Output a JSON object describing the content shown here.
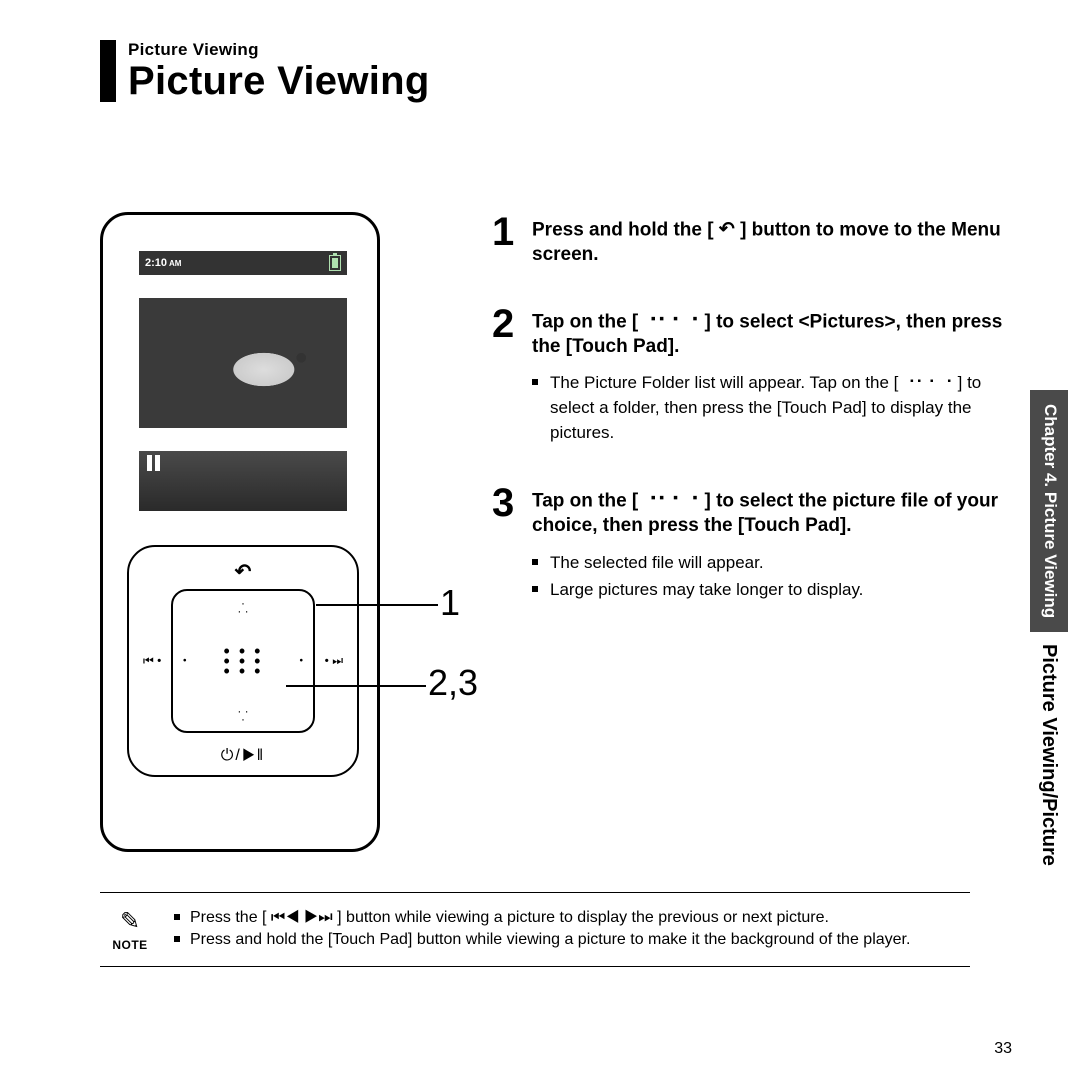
{
  "header": {
    "breadcrumb": "Picture Viewing",
    "title": "Picture Viewing"
  },
  "device": {
    "time": "2:10",
    "ampm": "AM",
    "callout_back": "1",
    "callout_pad": "2,3",
    "back_glyph": "↶",
    "power_glyph": "⏻/▶‖",
    "prev_glyph": "⏮ •",
    "next_glyph": "• ⏭"
  },
  "steps": [
    {
      "num": "1",
      "head_pre": "Press and hold the [ ",
      "head_glyph": "↶",
      "head_post": " ] button to move to the Menu screen.",
      "subs": []
    },
    {
      "num": "2",
      "head_pre": "Tap on the [ ",
      "head_glyph": "⠐⠂⠂⠐",
      "head_post": " ] to select <Pictures>, then press the [Touch Pad].",
      "subs": [
        "The Picture Folder list will appear. Tap on the [ ⠐⠂⠂⠐ ] to select a folder, then press the [Touch Pad] to display the pictures."
      ]
    },
    {
      "num": "3",
      "head_pre": "Tap on the [ ",
      "head_glyph": "⠐⠂⠂⠐",
      "head_post": " ] to select the picture file of your choice, then press the [Touch Pad].",
      "subs": [
        "The selected file will appear.",
        "Large pictures may take longer to display."
      ]
    }
  ],
  "note": {
    "icon": "✎",
    "label": "NOTE",
    "items": [
      "Press the [ ⏮◀ ▶⏭ ] button while viewing a picture to display the previous or next picture.",
      "Press and hold the [Touch Pad] button while viewing a picture to make it the background of the player."
    ]
  },
  "side": {
    "dark": "Chapter 4.  Picture Viewing",
    "light": "Picture Viewing/Picture"
  },
  "page_number": "33"
}
